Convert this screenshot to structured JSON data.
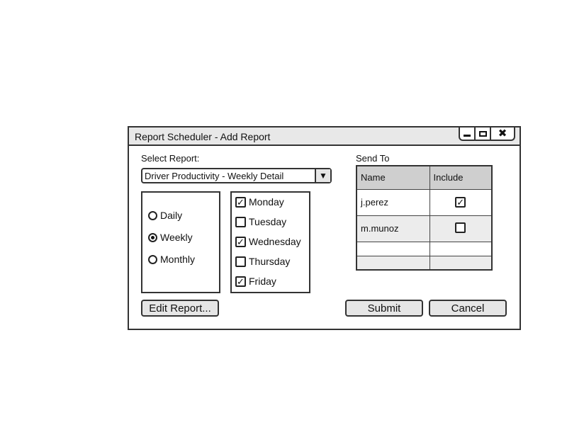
{
  "window": {
    "title": "Report Scheduler - Add Report",
    "controls": {
      "minimize": "minimize-icon",
      "maximize": "maximize-icon",
      "close": "close-icon"
    }
  },
  "report": {
    "label": "Select Report:",
    "selected": "Driver Productivity - Weekly Detail"
  },
  "frequency": {
    "options": [
      {
        "label": "Daily",
        "selected": false
      },
      {
        "label": "Weekly",
        "selected": true
      },
      {
        "label": "Monthly",
        "selected": false
      }
    ]
  },
  "days": [
    {
      "label": "Monday",
      "checked": true
    },
    {
      "label": "Tuesday",
      "checked": false
    },
    {
      "label": "Wednesday",
      "checked": true
    },
    {
      "label": "Thursday",
      "checked": false
    },
    {
      "label": "Friday",
      "checked": true
    }
  ],
  "send_to": {
    "label": "Send To",
    "columns": [
      "Name",
      "Include"
    ],
    "rows": [
      {
        "name": "j.perez",
        "include": true
      },
      {
        "name": "m.munoz",
        "include": false
      },
      {
        "name": "",
        "include": null
      },
      {
        "name": "",
        "include": null
      }
    ]
  },
  "buttons": {
    "edit_report": "Edit Report...",
    "submit": "Submit",
    "cancel": "Cancel"
  }
}
